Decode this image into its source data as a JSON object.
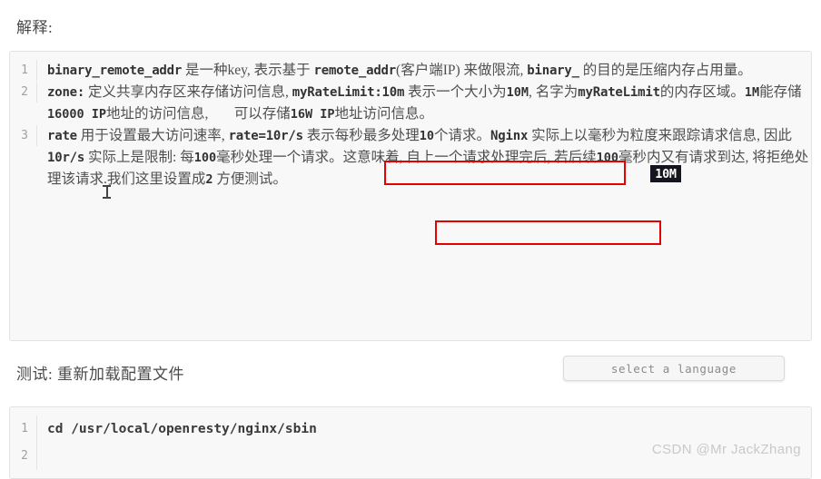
{
  "headings": {
    "explain": "解释:",
    "test": "测试: 重新加载配置文件"
  },
  "explain_block": {
    "line_numbers": [
      "1",
      "2",
      "3"
    ],
    "items": [
      {
        "number": "1",
        "segments": [
          {
            "text": "binary_remote_addr",
            "style": "mono"
          },
          {
            "text": " 是一种key, 表示基于 ",
            "style": "prose"
          },
          {
            "text": "remote_addr",
            "style": "mono"
          },
          {
            "text": "(客户端IP) 来做限流, ",
            "style": "prose"
          },
          {
            "text": "binary_",
            "style": "mono"
          },
          {
            "text": " 的目的是压缩内存占用量。",
            "style": "prose"
          }
        ],
        "plain": "binary_remote_addr 是一种key, 表示基于 remote_addr(客户端IP) 来做限流, binary_ 的目的是压缩内存占用量。"
      },
      {
        "number": "2",
        "segments": [
          {
            "text": "zone:",
            "style": "mono"
          },
          {
            "text": " 定义共享内存区来存储访问信息, ",
            "style": "prose"
          },
          {
            "text": "myRateLimit:10m",
            "style": "mono"
          },
          {
            "text": " 表示一个大小为",
            "style": "prose"
          },
          {
            "text": "10M",
            "style": "num"
          },
          {
            "text": ", 名字为",
            "style": "prose"
          },
          {
            "text": "myRateLimit",
            "style": "mono"
          },
          {
            "text": "的内存区域。",
            "style": "prose"
          },
          {
            "text": "1M",
            "style": "num"
          },
          {
            "text": "能存储",
            "style": "prose"
          },
          {
            "text": "16000",
            "style": "num"
          },
          {
            "text": " IP",
            "style": "num"
          },
          {
            "text": "地址的访问信息, ",
            "style": "prose"
          },
          {
            "text": "10M",
            "style": "highlight"
          },
          {
            "text": "可以存储",
            "style": "prose"
          },
          {
            "text": "16W",
            "style": "num"
          },
          {
            "text": " IP",
            "style": "num"
          },
          {
            "text": "地址访问信息。",
            "style": "prose"
          }
        ],
        "plain": "zone: 定义共享内存区来存储访问信息, myRateLimit:10m 表示一个大小为10M, 名字为myRateLimit的内存区域。1M能存储16000 IP地址的访问信息, 10M可以存储16W IP地址访问信息。"
      },
      {
        "number": "3",
        "segments": [
          {
            "text": "rate",
            "style": "mono"
          },
          {
            "text": " 用于设置最大访问速率, ",
            "style": "prose"
          },
          {
            "text": "rate=10r/s",
            "style": "mono"
          },
          {
            "text": " 表示每秒最多处理",
            "style": "prose"
          },
          {
            "text": "10",
            "style": "num"
          },
          {
            "text": "个请求",
            "style": "prose"
          },
          {
            "text": "。",
            "style": "prose"
          },
          {
            "text": "Nginx",
            "style": "mono"
          },
          {
            "text": " 实际上以毫秒为粒度来跟踪请求信息, 因此 ",
            "style": "prose"
          },
          {
            "text": "10r/s",
            "style": "mono"
          },
          {
            "text": " 实际上是限制: 每",
            "style": "prose"
          },
          {
            "text": "100",
            "style": "num"
          },
          {
            "text": "毫秒处理一个请求。这意味着, 自上一个请求处理完后, 若后续",
            "style": "prose"
          },
          {
            "text": "100",
            "style": "num"
          },
          {
            "text": "毫秒内又有请求到达, 将拒绝处理该请求.我们这里设置成",
            "style": "prose"
          },
          {
            "text": "2",
            "style": "num"
          },
          {
            "text": " 方便测试。",
            "style": "prose"
          }
        ],
        "plain": "rate 用于设置最大访问速率, rate=10r/s 表示每秒最多处理10个请求。Nginx 实际上以毫秒为粒度来跟踪请求信息, 因此 10r/s 实际上是限制: 每100毫秒处理一个请求。这意味着, 自上一个请求处理完后, 若后续100毫秒内又有请求到达, 将拒绝处理该请求.我们这里设置成2 方便测试。"
      }
    ]
  },
  "test_block": {
    "lines": [
      {
        "number": "1",
        "text": "cd /usr/local/openresty/nginx/sbin"
      },
      {
        "number": "2",
        "text": ""
      }
    ]
  },
  "language_chip": {
    "label": "select a language"
  },
  "watermark": {
    "text": "CSDN @Mr JackZhang"
  },
  "annotations": {
    "red_box_1_target": "1M能存储16000 IP地址的访问信息,",
    "red_box_2_target": "表示每秒最多处理10个请求",
    "selection_text": "10M",
    "colors": {
      "annotation_red": "#e60000",
      "selection_background": "#15151f",
      "selection_foreground": "#ffffff",
      "code_background": "#f8f8f8",
      "code_border": "#e3e3e3",
      "gutter_text": "#a0a0a0",
      "body_text": "#4f4f4f",
      "watermark": "#c9c9c9"
    }
  }
}
